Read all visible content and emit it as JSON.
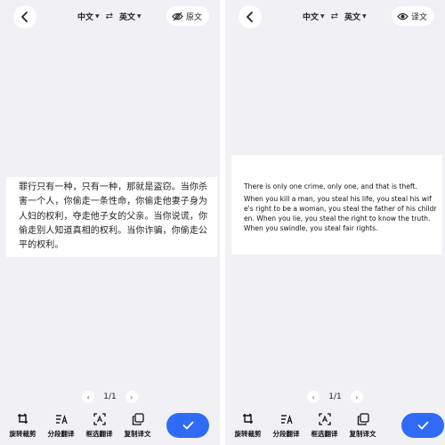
{
  "left": {
    "source_lang": "中文",
    "target_lang": "英文",
    "toggle_label": "原文",
    "text": "罪行只有一种，只有一种，那就是盗窃。当你杀害一个人，你偷走一条性命，你偷走他妻子身为人妇的权利，夺走他子女的父亲。当你说谎，你偷走别人知道真相的权利。当你诈骗，你偷走公平的权利。",
    "page": "1/1",
    "toolbar": [
      "旋转裁剪",
      "分段翻译",
      "框选翻译",
      "复制译文"
    ]
  },
  "right": {
    "source_lang": "中文",
    "target_lang": "英文",
    "toggle_label": "译文",
    "paragraphs": [
      "There is only one crime, only one, and that is theft.",
      "When you kill a man, you steal his life, you steal his wife's right to be a woman, you steal the father of his children. When you lie, you steal the right to know the truth. When you swindle, you steal fair rights."
    ],
    "page": "1/1",
    "toolbar": [
      "旋转裁剪",
      "分段翻译",
      "框选翻译",
      "复制译文"
    ]
  },
  "icons": {
    "back": "chevron-left-icon",
    "swap": "swap-arrows-icon",
    "hidden": "eye-off-icon",
    "visible": "eye-icon",
    "confirm": "checkmark-icon"
  },
  "colors": {
    "accent": "#2f6bf6",
    "panel_bg": "#f0f0f5"
  }
}
